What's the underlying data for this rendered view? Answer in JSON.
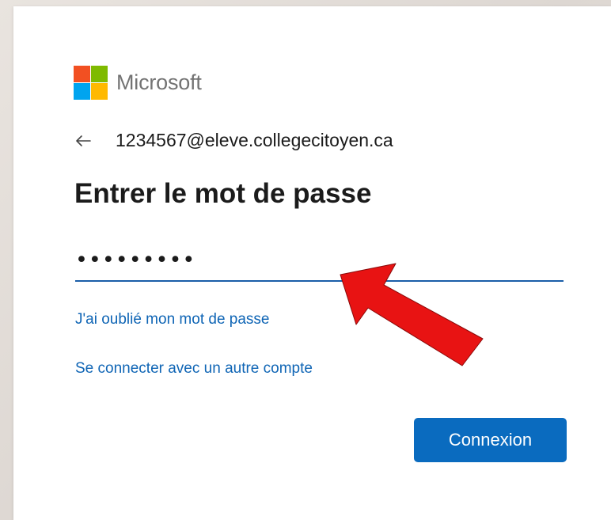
{
  "brand": {
    "name": "Microsoft",
    "logo_colors": [
      "#f25022",
      "#7fba00",
      "#00a4ef",
      "#ffb900"
    ]
  },
  "identity": {
    "back_icon": "arrow-left-icon",
    "email": "1234567@eleve.collegecitoyen.ca"
  },
  "page": {
    "title": "Entrer le mot de passe"
  },
  "password_field": {
    "value": "•••••••••",
    "accent": "#1a5ea8"
  },
  "links": {
    "forgot_password": "J'ai oublié mon mot de passe",
    "other_account": "Se connecter avec un autre compte"
  },
  "actions": {
    "submit_label": "Connexion",
    "submit_color": "#0a6bbf"
  },
  "annotation": {
    "arrow_color": "#e81313",
    "icon": "red-pointer-arrow-icon"
  }
}
